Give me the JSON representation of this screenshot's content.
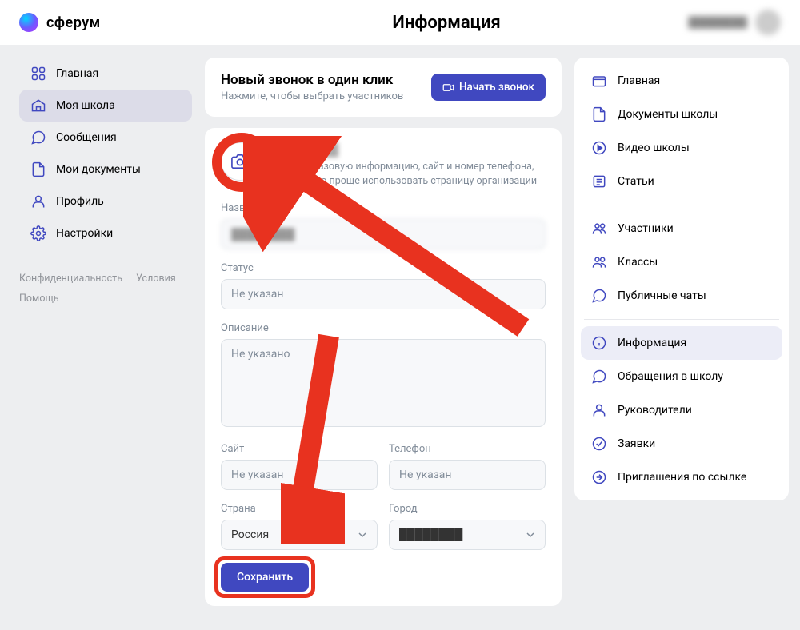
{
  "brand": "сферум",
  "page_title": "Информация",
  "user": {
    "name": "████████"
  },
  "sidebar": {
    "items": [
      {
        "label": "Главная"
      },
      {
        "label": "Моя школа",
        "active": true
      },
      {
        "label": "Сообщения"
      },
      {
        "label": "Мои документы"
      },
      {
        "label": "Профиль"
      },
      {
        "label": "Настройки"
      }
    ],
    "footer": [
      "Конфиденциальность",
      "Условия",
      "Помощь"
    ]
  },
  "call": {
    "title": "Новый звонок в один клик",
    "sub": "Нажмите, чтобы выбрать участников",
    "button": "Начать звонок"
  },
  "info": {
    "school_name": "████████",
    "description": "Укажите базовую информацию, сайт и номер телефона, чтобы было проще использовать страницу организации"
  },
  "form": {
    "name_label": "Название",
    "name_value": "████████",
    "status_label": "Статус",
    "status_placeholder": "Не указан",
    "desc_label": "Описание",
    "desc_placeholder": "Не указано",
    "site_label": "Сайт",
    "site_placeholder": "Не указан",
    "phone_label": "Телефон",
    "phone_placeholder": "Не указан",
    "country_label": "Страна",
    "country_value": "Россия",
    "city_label": "Город",
    "city_value": "████████",
    "save": "Сохранить"
  },
  "right": {
    "group1": [
      {
        "label": "Главная",
        "icon": "folder"
      },
      {
        "label": "Документы школы",
        "icon": "doc"
      },
      {
        "label": "Видео школы",
        "icon": "play"
      },
      {
        "label": "Статьи",
        "icon": "article"
      }
    ],
    "group2": [
      {
        "label": "Участники",
        "icon": "users"
      },
      {
        "label": "Классы",
        "icon": "users"
      },
      {
        "label": "Публичные чаты",
        "icon": "chat"
      }
    ],
    "group3": [
      {
        "label": "Информация",
        "icon": "info",
        "active": true
      },
      {
        "label": "Обращения в школу",
        "icon": "msg"
      },
      {
        "label": "Руководители",
        "icon": "user"
      },
      {
        "label": "Заявки",
        "icon": "check"
      },
      {
        "label": "Приглашения по ссылке",
        "icon": "link"
      }
    ]
  }
}
